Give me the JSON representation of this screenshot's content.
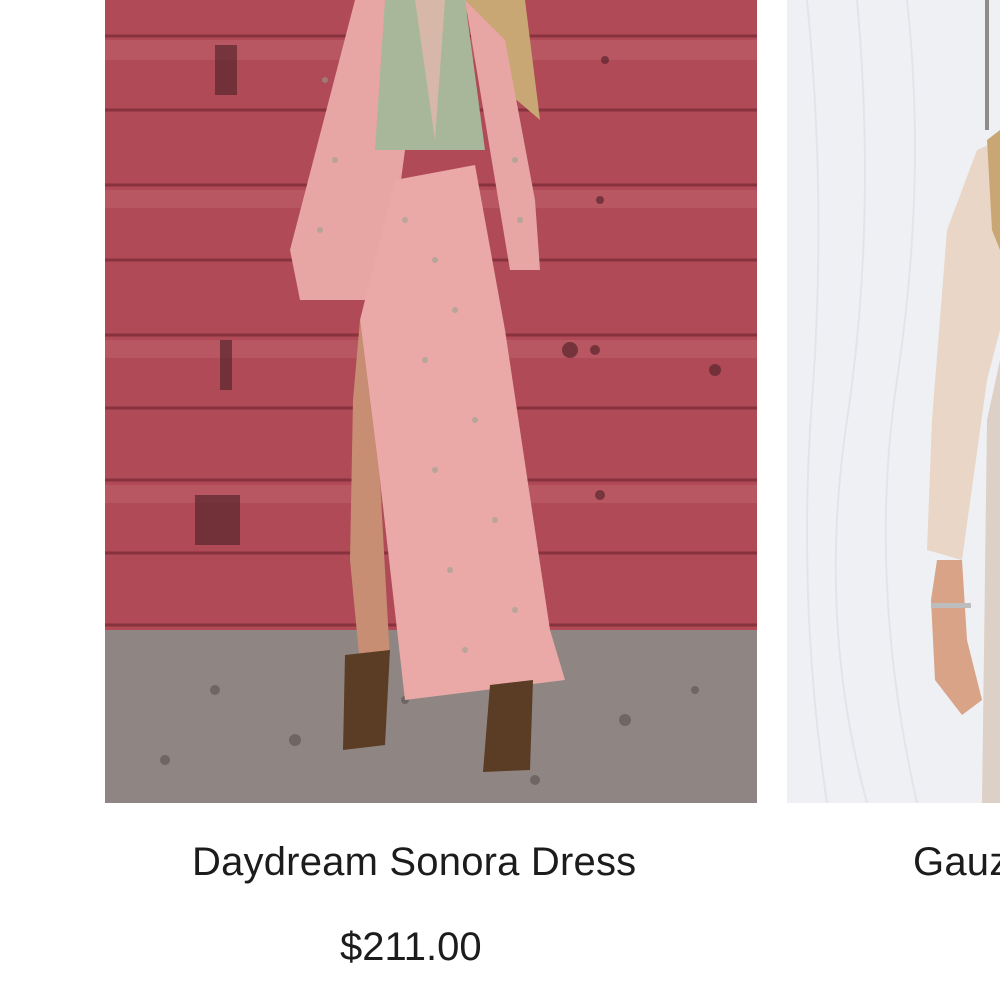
{
  "products": [
    {
      "title": "Daydream Sonora Dress",
      "price": "$211.00",
      "image": "pink-patterned-cutout-maxi-dress-photo"
    },
    {
      "title": "Gauz",
      "image": "cream-gauze-top-photo"
    }
  ],
  "colors": {
    "text": "#1c1c1c",
    "background": "#ffffff",
    "wall": "#b34e5a",
    "dress": "#e9a8a8"
  }
}
